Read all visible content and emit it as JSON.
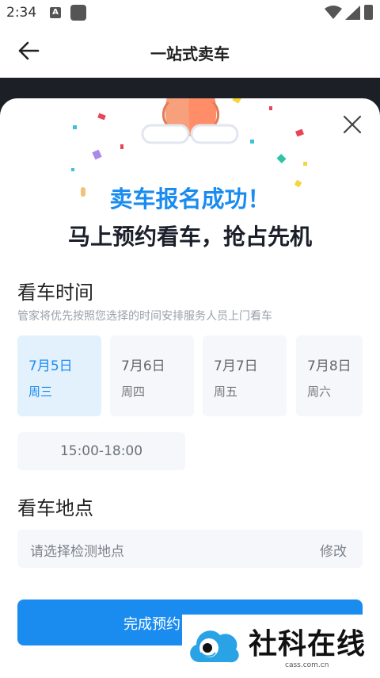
{
  "status_bar": {
    "time": "2:34",
    "a_badge": "A"
  },
  "app_bar": {
    "title": "一站式卖车"
  },
  "sheet": {
    "success_title": "卖车报名成功！",
    "success_subtitle": "马上预约看车，抢占先机"
  },
  "viewing_time": {
    "title": "看车时间",
    "description": "管家将优先按照您选择的时间安排服务人员上门看车",
    "dates": [
      {
        "date": "7月5日",
        "weekday": "周三",
        "selected": true
      },
      {
        "date": "7月6日",
        "weekday": "周四",
        "selected": false
      },
      {
        "date": "7月7日",
        "weekday": "周五",
        "selected": false
      },
      {
        "date": "7月8日",
        "weekday": "周六",
        "selected": false
      }
    ],
    "time_slot": "15:00-18:00"
  },
  "viewing_location": {
    "title": "看车地点",
    "placeholder": "请选择检测地点",
    "edit_label": "修改"
  },
  "submit": {
    "label": "完成预约"
  },
  "watermark": {
    "text": "社科在线",
    "url": "cass.com.cn"
  },
  "colors": {
    "accent": "#1a8cf0",
    "selected_bg": "#e3f1fd",
    "field_bg": "#f5f7fa"
  }
}
